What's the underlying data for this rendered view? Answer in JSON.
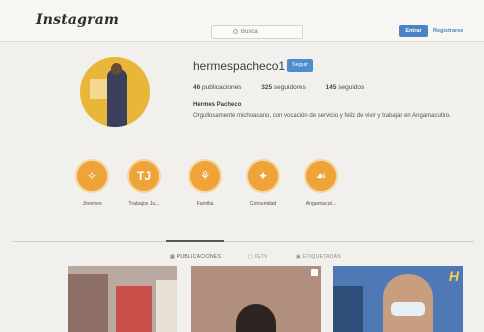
{
  "header": {
    "logo": "Instagram",
    "search_placeholder": "Busca",
    "login_label": "Entrar",
    "register_label": "Registrarse"
  },
  "profile": {
    "username": "hermespacheco1",
    "follow_label": "Seguir",
    "posts": "46",
    "posts_label": "publicaciones",
    "followers": "325",
    "followers_label": "seguidores",
    "following": "145",
    "following_label": "seguidos",
    "full_name": "Hermes Pacheco",
    "bio": "Orgullosamente michoacano, con vocación de servicio y feliz de vivir y trabajar en Angamacutiro."
  },
  "highlights": [
    {
      "label": "Jóvenes",
      "glyph": "✧"
    },
    {
      "label": "Trabajos Ju...",
      "glyph": "TJ"
    },
    {
      "label": "Familia",
      "glyph": "⚘"
    },
    {
      "label": "Comunidad",
      "glyph": "✦"
    },
    {
      "label": "Angamacut...",
      "glyph": "☙"
    }
  ],
  "tabs": [
    {
      "label": "PUBLICACIONES",
      "active": true
    },
    {
      "label": "IGTV",
      "active": false
    },
    {
      "label": "ETIQUETADAS",
      "active": false
    }
  ],
  "colors": {
    "accent": "#4b84c4",
    "highlight": "#efa43a",
    "background": "#f1f0ec"
  }
}
